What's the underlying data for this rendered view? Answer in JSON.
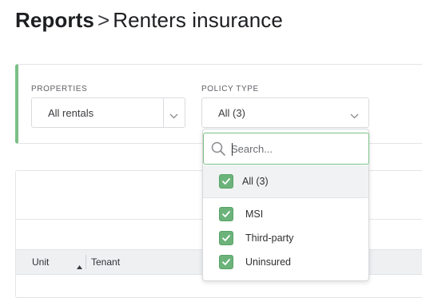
{
  "breadcrumb": {
    "root": "Reports",
    "separator": ">",
    "current": "Renters insurance"
  },
  "filters": {
    "properties": {
      "label": "PROPERTIES",
      "value": "All rentals"
    },
    "policy_type": {
      "label": "POLICY TYPE",
      "value": "All (3)"
    }
  },
  "dropdown": {
    "search_placeholder": "Search...",
    "all_option": {
      "label": "All (3)",
      "checked": true
    },
    "options": [
      {
        "label": "MSI",
        "checked": true
      },
      {
        "label": "Third-party",
        "checked": true
      },
      {
        "label": "Uninsured",
        "checked": true
      }
    ]
  },
  "table": {
    "columns": [
      "Unit",
      "Tenant"
    ]
  },
  "colors": {
    "accent_green": "#7bbf86",
    "checkbox_green": "#6bb37a"
  },
  "icons": [
    "search-icon",
    "chevron-down-icon",
    "check-icon",
    "sort-asc-icon"
  ]
}
